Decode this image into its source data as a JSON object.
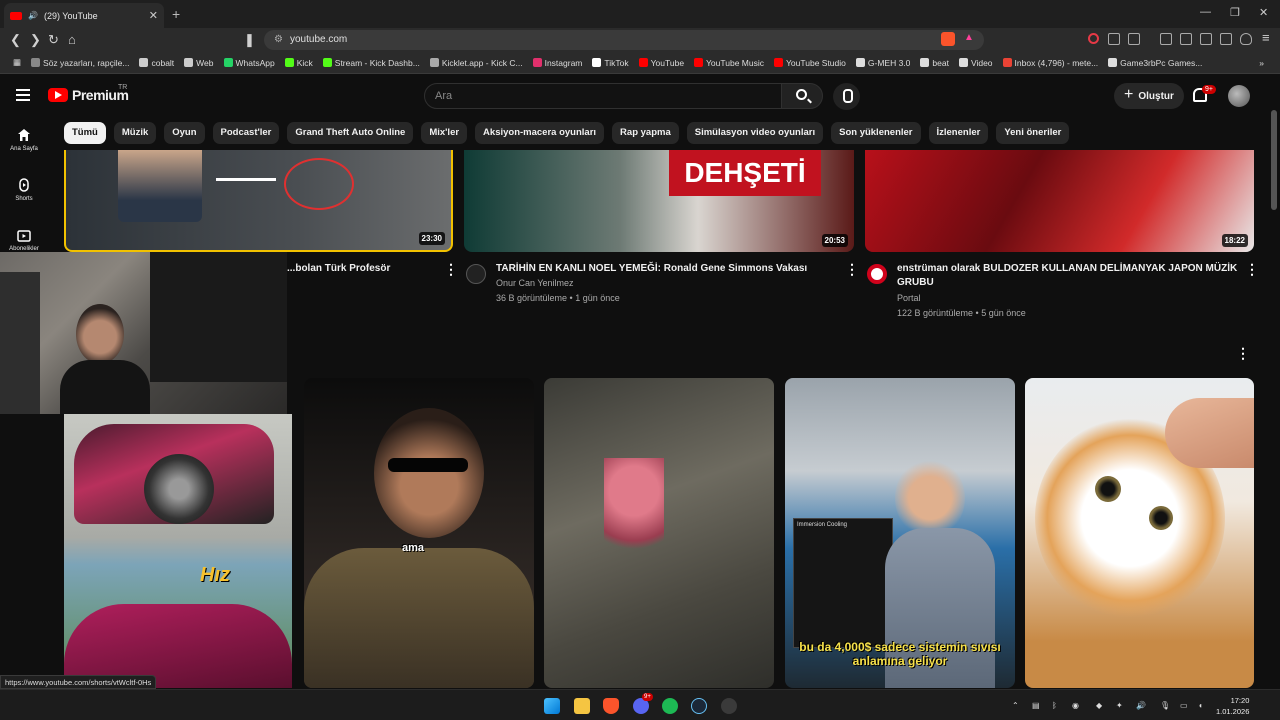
{
  "browser": {
    "tab_title": "(29) YouTube",
    "url": "youtube.com",
    "bookmarks": [
      {
        "label": "Söz yazarları, rapçile...",
        "color": "#888888"
      },
      {
        "label": "cobalt",
        "color": "#cccccc"
      },
      {
        "label": "Web",
        "color": "#cccccc"
      },
      {
        "label": "WhatsApp",
        "color": "#25d366"
      },
      {
        "label": "Kick",
        "color": "#53fc18"
      },
      {
        "label": "Stream - Kick Dashb...",
        "color": "#53fc18"
      },
      {
        "label": "Kicklet.app - Kick C...",
        "color": "#aaaaaa"
      },
      {
        "label": "Instagram",
        "color": "#e1306c"
      },
      {
        "label": "TikTok",
        "color": "#ffffff"
      },
      {
        "label": "YouTube",
        "color": "#ff0000"
      },
      {
        "label": "YouTube Music",
        "color": "#ff0000"
      },
      {
        "label": "YouTube Studio",
        "color": "#ff0000"
      },
      {
        "label": "G-MEH 3.0",
        "color": "#dddddd"
      },
      {
        "label": "beat",
        "color": "#dddddd"
      },
      {
        "label": "Video",
        "color": "#dddddd"
      },
      {
        "label": "Inbox (4,796) - mete...",
        "color": "#ea4335"
      },
      {
        "label": "Game3rbPc Games...",
        "color": "#dddddd"
      }
    ],
    "status_url": "https://www.youtube.com/shorts/vtWcltf-0Hs"
  },
  "youtube": {
    "logo_text": "Premium",
    "logo_region": "TR",
    "search_placeholder": "Ara",
    "create_label": "Oluştur",
    "notif_count": "9+",
    "sidebar": [
      {
        "label": "Ana Sayfa",
        "icon": "home-icon"
      },
      {
        "label": "Shorts",
        "icon": "shorts-icon"
      },
      {
        "label": "Abonelikler",
        "icon": "subscriptions-icon"
      }
    ],
    "chips": [
      "Tümü",
      "Müzik",
      "Oyun",
      "Podcast'ler",
      "Grand Theft Auto Online",
      "Mix'ler",
      "Aksiyon-macera oyunları",
      "Rap yapma",
      "Simülasyon video oyunları",
      "Son yüklenenler",
      "İzlenenler",
      "Yeni öneriler"
    ],
    "videos": [
      {
        "title": "...bolan Türk Profesör",
        "duration": "23:30",
        "channel": "",
        "meta": ""
      },
      {
        "title": "TARİHİN EN KANLI NOEL YEMEĞİ: Ronald Gene Simmons Vakası",
        "duration": "20:53",
        "channel": "Onur Can Yenilmez",
        "meta": "36 B görüntüleme • 1 gün önce",
        "thumb_text": "DEHŞETİ"
      },
      {
        "title": "enstrüman olarak BULDOZER KULLANAN DELİMANYAK JAPON MÜZİK GRUBU",
        "duration": "18:22",
        "channel": "Portal",
        "meta": "122 B görüntüleme • 5 gün önce"
      }
    ],
    "shorts_captions": {
      "short_hiz": "Hız",
      "short_ama": "ama",
      "short_pc": "bu da 4,000$ sadece sistemin sıvısı anlamına geliyor",
      "short_pc_label": "Immersion Cooling"
    }
  },
  "taskbar": {
    "time": "17:20",
    "date": "1.01.2026",
    "discord_badge": "9+"
  },
  "colors": {
    "yt_red": "#ff0000",
    "background": "#0f0f0f",
    "chip_bg": "#272727"
  }
}
